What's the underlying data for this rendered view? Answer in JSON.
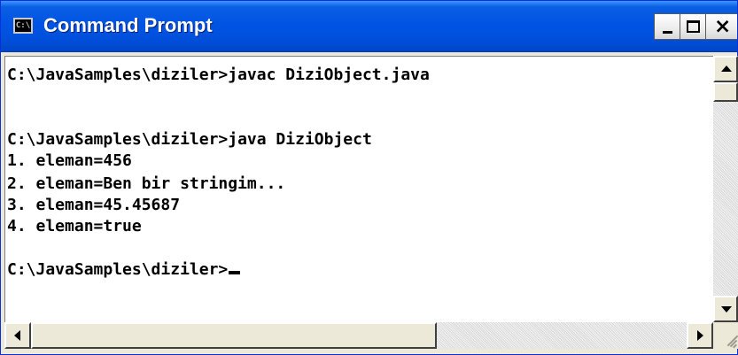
{
  "window": {
    "title": "Command Prompt",
    "icon": "cmd-icon",
    "icon_text": "C:\\",
    "controls": {
      "minimize": "minimize-icon",
      "maximize": "maximize-icon",
      "close": "close-icon",
      "close_glyph": "×"
    }
  },
  "console": {
    "lines": [
      "C:\\JavaSamples\\diziler>javac DiziObject.java",
      "",
      "C:\\JavaSamples\\diziler>java DiziObject",
      "1. eleman=456",
      "2. eleman=Ben bir stringim...",
      "3. eleman=45.45687",
      "4. eleman=true",
      "",
      "C:\\JavaSamples\\diziler>"
    ]
  },
  "colors": {
    "titlebar": "#0054e3",
    "title_text": "#ffffff",
    "console_bg": "#ffffff",
    "console_text": "#000000"
  }
}
